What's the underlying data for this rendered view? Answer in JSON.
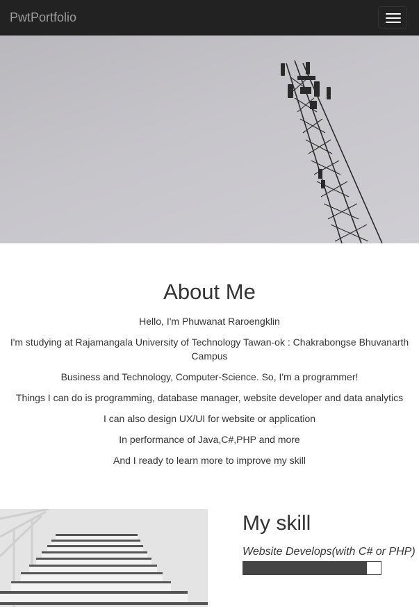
{
  "navbar": {
    "brand": "PwtPortfolio",
    "menu_icon": "hamburger-menu-icon"
  },
  "hero": {
    "image": "telecom-tower-photo"
  },
  "about": {
    "title": "About Me",
    "lines": [
      "Hello, I'm Phuwanat Raroengklin",
      "I'm studying at Rajamangala University of Technology Tawan-ok : Chakrabongse Bhuvanarth Campus",
      "Business and Technology, Computer-Science. So, I'm a programmer!",
      "Things I can do is programming, database manager, website developer and data analytics",
      "I can also design UX/UI for website or application",
      "In performance of Java,C#,PHP and more",
      "And I ready to learn more to improve my skill"
    ]
  },
  "skills": {
    "title": "My skill",
    "image": "stairs-photo",
    "items": [
      {
        "label": "Website Develops(with C# or PHP)",
        "progress_percent": 90
      }
    ]
  },
  "colors": {
    "navbar_bg": "#222222",
    "brand_text": "#9d9d9d",
    "progress_fill": "#444444"
  }
}
